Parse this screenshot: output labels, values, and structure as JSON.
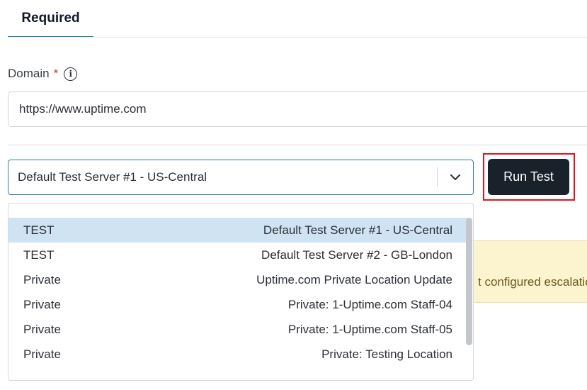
{
  "tab": {
    "label": "Required"
  },
  "domain": {
    "label": "Domain",
    "required_mark": "*",
    "value": "https://www.uptime.com"
  },
  "location_select": {
    "selected": "Default Test Server #1 - US-Central",
    "options": [
      {
        "type": "TEST",
        "name": "Default Test Server #1 - US-Central",
        "selected": true
      },
      {
        "type": "TEST",
        "name": "Default Test Server #2 - GB-London",
        "selected": false
      },
      {
        "type": "Private",
        "name": "Uptime.com Private Location Update",
        "selected": false
      },
      {
        "type": "Private",
        "name": "Private: 1-Uptime.com Staff-04",
        "selected": false
      },
      {
        "type": "Private",
        "name": "Private: 1-Uptime.com Staff-05",
        "selected": false
      },
      {
        "type": "Private",
        "name": "Private: Testing Location",
        "selected": false
      }
    ]
  },
  "run_test": {
    "label": "Run Test"
  },
  "warning": {
    "text": "t configured escalatio"
  },
  "icons": {
    "info": "info-icon",
    "chevron": "chevron-down-icon"
  },
  "colors": {
    "accent": "#2f7ea8",
    "button_bg": "#19212b",
    "highlight": "#e0141c",
    "required": "#d13b3b",
    "selected_option_bg": "#cfe3f3",
    "warning_bg": "#fcf3cf"
  }
}
